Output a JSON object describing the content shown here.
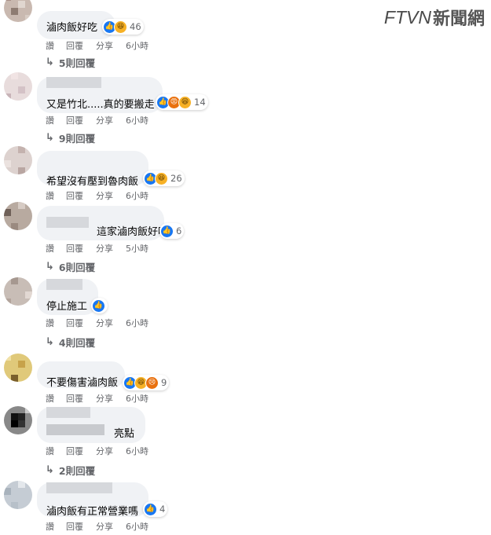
{
  "logo": {
    "brand": "FTVN",
    "name": "新聞網"
  },
  "actions": {
    "like": "讚",
    "reply": "回覆",
    "share": "分享"
  },
  "comments": [
    {
      "text": "滷肉飯好吃",
      "count": "46",
      "time": "6小時",
      "replies": "5則回覆",
      "reactions": [
        "like",
        "haha"
      ]
    },
    {
      "text": "又是竹北.....真的要搬走",
      "count": "14",
      "time": "6小時",
      "replies": "9則回覆",
      "reactions": [
        "like",
        "angry",
        "haha"
      ]
    },
    {
      "text": "希望沒有壓到魯肉飯",
      "count": "26",
      "time": "6小時",
      "replies": "",
      "reactions": [
        "like",
        "haha"
      ]
    },
    {
      "text": "這家滷肉飯好吃",
      "count": "6",
      "time": "5小時",
      "replies": "6則回覆",
      "reactions": [
        "like"
      ]
    },
    {
      "text": "停止施工",
      "count": "",
      "time": "6小時",
      "replies": "4則回覆",
      "reactions": [
        "like"
      ]
    },
    {
      "text": "不要傷害滷肉飯",
      "count": "9",
      "time": "6小時",
      "replies": "",
      "reactions": [
        "like",
        "haha",
        "angry"
      ]
    },
    {
      "text": "亮點",
      "count": "",
      "time": "6小時",
      "replies": "2則回覆",
      "reactions": []
    },
    {
      "text": "滷肉飯有正常營業嗎",
      "count": "4",
      "time": "6小時",
      "replies": "",
      "reactions": [
        "like"
      ]
    }
  ]
}
